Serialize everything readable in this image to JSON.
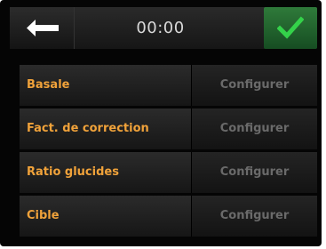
{
  "header": {
    "time": "00:00",
    "back_icon": "left-arrow-icon",
    "confirm_icon": "check-icon",
    "confirm_color": "#2ecc40"
  },
  "rows": [
    {
      "label": "Basale",
      "action": "Configurer"
    },
    {
      "label": "Fact. de correction",
      "action": "Configurer"
    },
    {
      "label": "Ratio glucides",
      "action": "Configurer"
    },
    {
      "label": "Cible",
      "action": "Configurer"
    }
  ],
  "colors": {
    "label_text": "#f0a23a",
    "action_text": "#6a6a6a",
    "background": "#050505"
  }
}
